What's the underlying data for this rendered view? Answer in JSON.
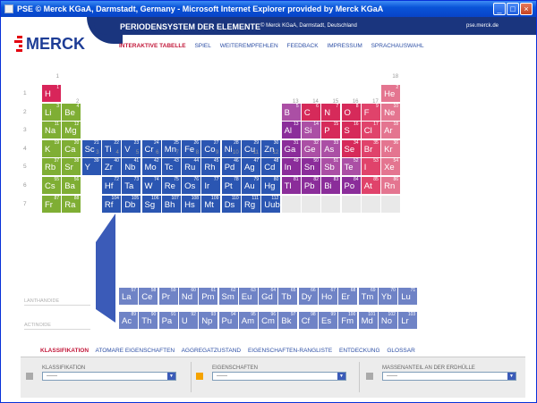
{
  "window": {
    "title": "PSE © Merck KGaA, Darmstadt, Germany - Microsoft Internet Explorer provided by Merck KGaA"
  },
  "logo": {
    "text": "MERCK"
  },
  "header": {
    "title": "PERIODENSYSTEM DER ELEMENTE",
    "copyright": "© Merck KGaA, Darmstadt, Deutschland",
    "site": "pse.merck.de"
  },
  "nav": [
    "INTERAKTIVE TABELLE",
    "SPIEL",
    "WEITEREMPFEHLEN",
    "FEEDBACK",
    "IMPRESSUM",
    "SPRACHAUSWAHL"
  ],
  "groups": [
    "1",
    "2",
    "3",
    "4",
    "5",
    "6",
    "7",
    "8",
    "9",
    "10",
    "11",
    "12",
    "13",
    "14",
    "15",
    "16",
    "17",
    "18"
  ],
  "periods": [
    "1",
    "2",
    "3",
    "4",
    "5",
    "6",
    "7"
  ],
  "series_labels": {
    "lanthanides": "LANTHANOIDE",
    "actinides": "ACTINOIDE"
  },
  "colors": {
    "alkali": "#d8255a",
    "alkaline": "#7fae34",
    "transition": "#2b56b2",
    "post": "#8b2d9a",
    "metalloid": "#ab4fa5",
    "nonmetal": "#d62a5a",
    "halogen": "#e0436b",
    "noble": "#e47590",
    "hydrogen": "#d8255a",
    "lanth": "#6f83c6",
    "unknown": "#e9e9e9"
  },
  "elements": [
    {
      "n": "1",
      "s": "H",
      "g": 1,
      "p": 1,
      "c": "hydrogen"
    },
    {
      "n": "2",
      "s": "He",
      "g": 18,
      "p": 1,
      "c": "noble"
    },
    {
      "n": "3",
      "s": "Li",
      "g": 1,
      "p": 2,
      "c": "alkaline"
    },
    {
      "n": "4",
      "s": "Be",
      "g": 2,
      "p": 2,
      "c": "alkaline"
    },
    {
      "n": "5",
      "s": "B",
      "g": 13,
      "p": 2,
      "c": "metalloid"
    },
    {
      "n": "6",
      "s": "C",
      "g": 14,
      "p": 2,
      "c": "nonmetal"
    },
    {
      "n": "7",
      "s": "N",
      "g": 15,
      "p": 2,
      "c": "nonmetal"
    },
    {
      "n": "8",
      "s": "O",
      "g": 16,
      "p": 2,
      "c": "nonmetal"
    },
    {
      "n": "9",
      "s": "F",
      "g": 17,
      "p": 2,
      "c": "halogen"
    },
    {
      "n": "10",
      "s": "Ne",
      "g": 18,
      "p": 2,
      "c": "noble"
    },
    {
      "n": "11",
      "s": "Na",
      "g": 1,
      "p": 3,
      "c": "alkaline"
    },
    {
      "n": "12",
      "s": "Mg",
      "g": 2,
      "p": 3,
      "c": "alkaline"
    },
    {
      "n": "13",
      "s": "Al",
      "g": 13,
      "p": 3,
      "c": "post"
    },
    {
      "n": "14",
      "s": "Si",
      "g": 14,
      "p": 3,
      "c": "metalloid"
    },
    {
      "n": "15",
      "s": "P",
      "g": 15,
      "p": 3,
      "c": "nonmetal"
    },
    {
      "n": "16",
      "s": "S",
      "g": 16,
      "p": 3,
      "c": "nonmetal"
    },
    {
      "n": "17",
      "s": "Cl",
      "g": 17,
      "p": 3,
      "c": "halogen"
    },
    {
      "n": "18",
      "s": "Ar",
      "g": 18,
      "p": 3,
      "c": "noble"
    },
    {
      "n": "19",
      "s": "K",
      "g": 1,
      "p": 4,
      "c": "alkaline"
    },
    {
      "n": "20",
      "s": "Ca",
      "g": 2,
      "p": 4,
      "c": "alkaline"
    },
    {
      "n": "21",
      "s": "Sc",
      "g": 3,
      "p": 4,
      "c": "transition"
    },
    {
      "n": "22",
      "s": "Ti",
      "g": 4,
      "p": 4,
      "c": "transition"
    },
    {
      "n": "23",
      "s": "V",
      "g": 5,
      "p": 4,
      "c": "transition"
    },
    {
      "n": "24",
      "s": "Cr",
      "g": 6,
      "p": 4,
      "c": "transition"
    },
    {
      "n": "25",
      "s": "Mn",
      "g": 7,
      "p": 4,
      "c": "transition"
    },
    {
      "n": "26",
      "s": "Fe",
      "g": 8,
      "p": 4,
      "c": "transition"
    },
    {
      "n": "27",
      "s": "Co",
      "g": 9,
      "p": 4,
      "c": "transition"
    },
    {
      "n": "28",
      "s": "Ni",
      "g": 10,
      "p": 4,
      "c": "transition"
    },
    {
      "n": "29",
      "s": "Cu",
      "g": 11,
      "p": 4,
      "c": "transition"
    },
    {
      "n": "30",
      "s": "Zn",
      "g": 12,
      "p": 4,
      "c": "transition"
    },
    {
      "n": "31",
      "s": "Ga",
      "g": 13,
      "p": 4,
      "c": "post"
    },
    {
      "n": "32",
      "s": "Ge",
      "g": 14,
      "p": 4,
      "c": "metalloid"
    },
    {
      "n": "33",
      "s": "As",
      "g": 15,
      "p": 4,
      "c": "metalloid"
    },
    {
      "n": "34",
      "s": "Se",
      "g": 16,
      "p": 4,
      "c": "nonmetal"
    },
    {
      "n": "35",
      "s": "Br",
      "g": 17,
      "p": 4,
      "c": "halogen"
    },
    {
      "n": "36",
      "s": "Kr",
      "g": 18,
      "p": 4,
      "c": "noble"
    },
    {
      "n": "37",
      "s": "Rb",
      "g": 1,
      "p": 5,
      "c": "alkaline"
    },
    {
      "n": "38",
      "s": "Sr",
      "g": 2,
      "p": 5,
      "c": "alkaline"
    },
    {
      "n": "39",
      "s": "Y",
      "g": 3,
      "p": 5,
      "c": "transition"
    },
    {
      "n": "40",
      "s": "Zr",
      "g": 4,
      "p": 5,
      "c": "transition"
    },
    {
      "n": "41",
      "s": "Nb",
      "g": 5,
      "p": 5,
      "c": "transition"
    },
    {
      "n": "42",
      "s": "Mo",
      "g": 6,
      "p": 5,
      "c": "transition"
    },
    {
      "n": "43",
      "s": "Tc",
      "g": 7,
      "p": 5,
      "c": "transition"
    },
    {
      "n": "44",
      "s": "Ru",
      "g": 8,
      "p": 5,
      "c": "transition"
    },
    {
      "n": "45",
      "s": "Rh",
      "g": 9,
      "p": 5,
      "c": "transition"
    },
    {
      "n": "46",
      "s": "Pd",
      "g": 10,
      "p": 5,
      "c": "transition"
    },
    {
      "n": "47",
      "s": "Ag",
      "g": 11,
      "p": 5,
      "c": "transition"
    },
    {
      "n": "48",
      "s": "Cd",
      "g": 12,
      "p": 5,
      "c": "transition"
    },
    {
      "n": "49",
      "s": "In",
      "g": 13,
      "p": 5,
      "c": "post"
    },
    {
      "n": "50",
      "s": "Sn",
      "g": 14,
      "p": 5,
      "c": "post"
    },
    {
      "n": "51",
      "s": "Sb",
      "g": 15,
      "p": 5,
      "c": "metalloid"
    },
    {
      "n": "52",
      "s": "Te",
      "g": 16,
      "p": 5,
      "c": "metalloid"
    },
    {
      "n": "53",
      "s": "I",
      "g": 17,
      "p": 5,
      "c": "halogen"
    },
    {
      "n": "54",
      "s": "Xe",
      "g": 18,
      "p": 5,
      "c": "noble"
    },
    {
      "n": "55",
      "s": "Cs",
      "g": 1,
      "p": 6,
      "c": "alkaline"
    },
    {
      "n": "56",
      "s": "Ba",
      "g": 2,
      "p": 6,
      "c": "alkaline"
    },
    {
      "n": "72",
      "s": "Hf",
      "g": 4,
      "p": 6,
      "c": "transition"
    },
    {
      "n": "73",
      "s": "Ta",
      "g": 5,
      "p": 6,
      "c": "transition"
    },
    {
      "n": "74",
      "s": "W",
      "g": 6,
      "p": 6,
      "c": "transition"
    },
    {
      "n": "75",
      "s": "Re",
      "g": 7,
      "p": 6,
      "c": "transition"
    },
    {
      "n": "76",
      "s": "Os",
      "g": 8,
      "p": 6,
      "c": "transition"
    },
    {
      "n": "77",
      "s": "Ir",
      "g": 9,
      "p": 6,
      "c": "transition"
    },
    {
      "n": "78",
      "s": "Pt",
      "g": 10,
      "p": 6,
      "c": "transition"
    },
    {
      "n": "79",
      "s": "Au",
      "g": 11,
      "p": 6,
      "c": "transition"
    },
    {
      "n": "80",
      "s": "Hg",
      "g": 12,
      "p": 6,
      "c": "transition"
    },
    {
      "n": "81",
      "s": "Tl",
      "g": 13,
      "p": 6,
      "c": "post"
    },
    {
      "n": "82",
      "s": "Pb",
      "g": 14,
      "p": 6,
      "c": "post"
    },
    {
      "n": "83",
      "s": "Bi",
      "g": 15,
      "p": 6,
      "c": "post"
    },
    {
      "n": "84",
      "s": "Po",
      "g": 16,
      "p": 6,
      "c": "post"
    },
    {
      "n": "85",
      "s": "At",
      "g": 17,
      "p": 6,
      "c": "halogen"
    },
    {
      "n": "86",
      "s": "Rn",
      "g": 18,
      "p": 6,
      "c": "noble"
    },
    {
      "n": "87",
      "s": "Fr",
      "g": 1,
      "p": 7,
      "c": "alkaline"
    },
    {
      "n": "88",
      "s": "Ra",
      "g": 2,
      "p": 7,
      "c": "alkaline"
    },
    {
      "n": "104",
      "s": "Rf",
      "g": 4,
      "p": 7,
      "c": "transition"
    },
    {
      "n": "105",
      "s": "Db",
      "g": 5,
      "p": 7,
      "c": "transition"
    },
    {
      "n": "106",
      "s": "Sg",
      "g": 6,
      "p": 7,
      "c": "transition"
    },
    {
      "n": "107",
      "s": "Bh",
      "g": 7,
      "p": 7,
      "c": "transition"
    },
    {
      "n": "108",
      "s": "Hs",
      "g": 8,
      "p": 7,
      "c": "transition"
    },
    {
      "n": "109",
      "s": "Mt",
      "g": 9,
      "p": 7,
      "c": "transition"
    },
    {
      "n": "110",
      "s": "Ds",
      "g": 10,
      "p": 7,
      "c": "transition"
    },
    {
      "n": "111",
      "s": "Rg",
      "g": 11,
      "p": 7,
      "c": "transition"
    },
    {
      "n": "112",
      "s": "Uub",
      "g": 12,
      "p": 7,
      "c": "transition"
    },
    {
      "n": "",
      "s": "",
      "g": 13,
      "p": 7,
      "c": "unknown"
    },
    {
      "n": "",
      "s": "",
      "g": 14,
      "p": 7,
      "c": "unknown"
    },
    {
      "n": "",
      "s": "",
      "g": 15,
      "p": 7,
      "c": "unknown"
    },
    {
      "n": "",
      "s": "",
      "g": 16,
      "p": 7,
      "c": "unknown"
    },
    {
      "n": "",
      "s": "",
      "g": 17,
      "p": 7,
      "c": "unknown"
    },
    {
      "n": "",
      "s": "",
      "g": 18,
      "p": 7,
      "c": "unknown"
    }
  ],
  "lanthanides": [
    {
      "n": "57",
      "s": "La"
    },
    {
      "n": "58",
      "s": "Ce"
    },
    {
      "n": "59",
      "s": "Pr"
    },
    {
      "n": "60",
      "s": "Nd"
    },
    {
      "n": "61",
      "s": "Pm"
    },
    {
      "n": "62",
      "s": "Sm"
    },
    {
      "n": "63",
      "s": "Eu"
    },
    {
      "n": "64",
      "s": "Gd"
    },
    {
      "n": "65",
      "s": "Tb"
    },
    {
      "n": "66",
      "s": "Dy"
    },
    {
      "n": "67",
      "s": "Ho"
    },
    {
      "n": "68",
      "s": "Er"
    },
    {
      "n": "69",
      "s": "Tm"
    },
    {
      "n": "70",
      "s": "Yb"
    },
    {
      "n": "71",
      "s": "Lu"
    }
  ],
  "actinides": [
    {
      "n": "89",
      "s": "Ac"
    },
    {
      "n": "90",
      "s": "Th"
    },
    {
      "n": "91",
      "s": "Pa"
    },
    {
      "n": "92",
      "s": "U"
    },
    {
      "n": "93",
      "s": "Np"
    },
    {
      "n": "94",
      "s": "Pu"
    },
    {
      "n": "95",
      "s": "Am"
    },
    {
      "n": "96",
      "s": "Cm"
    },
    {
      "n": "97",
      "s": "Bk"
    },
    {
      "n": "98",
      "s": "Cf"
    },
    {
      "n": "99",
      "s": "Es"
    },
    {
      "n": "100",
      "s": "Fm"
    },
    {
      "n": "101",
      "s": "Md"
    },
    {
      "n": "102",
      "s": "No"
    },
    {
      "n": "103",
      "s": "Lr"
    }
  ],
  "bottom_tabs": [
    "KLASSIFIKATION",
    "ATOMARE EIGENSCHAFTEN",
    "AGGREGATZUSTAND",
    "EIGENSCHAFTEN-RANGLISTE",
    "ENTDECKUNG",
    "GLOSSAR"
  ],
  "panel": {
    "klass_label": "KLASSIFIKATION",
    "eigen_label": "EIGENSCHAFTEN",
    "masse_label": "MASSENANTEIL AN DER ERDHÜLLE",
    "select_value": "------",
    "eigen_color": "#f5a300"
  }
}
